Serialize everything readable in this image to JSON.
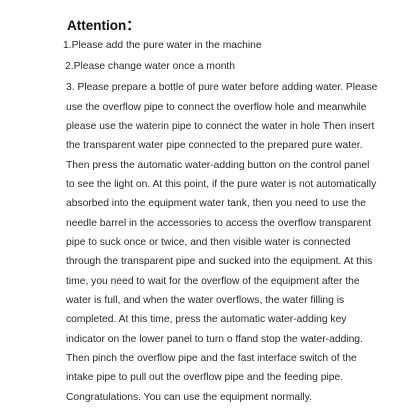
{
  "document": {
    "title": "Attention：",
    "item1": "1.Please add the pure water in the machine",
    "item2": "2.Please change water once a month",
    "item3_lines": [
      "3. Please prepare a bottle of pure water before adding water. Please",
      "use the overflow pipe to connect the overflow hole and meanwhile",
      "please  use the waterin pipe to connect the water in hole Then insert",
      "the transparent water pipe connected to the prepared pure water.",
      "Then press the automatic water-adding button on the control panel",
      "to see the light on. At this point, if the pure water is not automatically",
      "absorbed into the equipment water tank, then you need to use the",
      "needle barrel in the accessories to access the overflow transparent",
      "pipe to suck once or twice, and then visible water is connected",
      "through the transparent pipe and sucked into the equipment. At this",
      "time, you need to wait for the overflow of the equipment after the",
      "water is full, and when the water overflows, the water filling is",
      "completed. At this time,  press the automatic water-adding key",
      "indicator on the lower panel to turn o ffand stop the water-adding.",
      "Then pinch the overflow pipe and the fast interface switch of the",
      "intake pipe to pull out the overflow pipe and the feeding pipe.",
      "Congratulations. You can use the equipment normally."
    ]
  }
}
